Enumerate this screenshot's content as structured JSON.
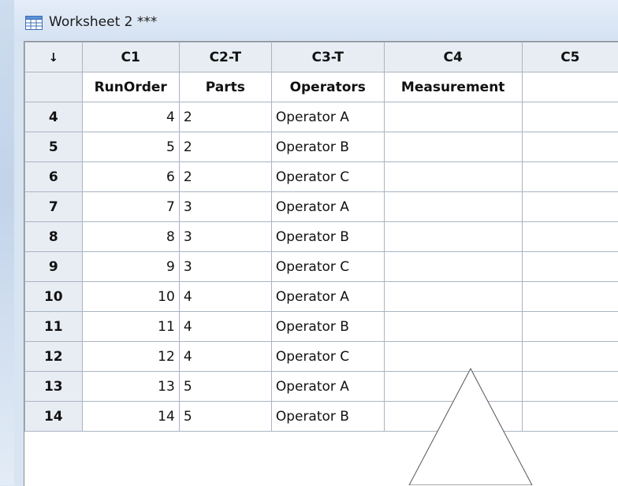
{
  "window": {
    "title": "Worksheet 2 ***",
    "icon": "worksheet-grid-icon"
  },
  "grid": {
    "corner_label": "↓",
    "column_ids": [
      "C1",
      "C2-T",
      "C3-T",
      "C4",
      "C5"
    ],
    "column_names": [
      "RunOrder",
      "Parts",
      "Operators",
      "Measurement",
      ""
    ],
    "rows": [
      {
        "row": "4",
        "c1": "4",
        "c2": "2",
        "c3": "Operator A",
        "c4": "",
        "c5": ""
      },
      {
        "row": "5",
        "c1": "5",
        "c2": "2",
        "c3": "Operator B",
        "c4": "",
        "c5": ""
      },
      {
        "row": "6",
        "c1": "6",
        "c2": "2",
        "c3": "Operator C",
        "c4": "",
        "c5": ""
      },
      {
        "row": "7",
        "c1": "7",
        "c2": "3",
        "c3": "Operator A",
        "c4": "",
        "c5": ""
      },
      {
        "row": "8",
        "c1": "8",
        "c2": "3",
        "c3": "Operator B",
        "c4": "",
        "c5": ""
      },
      {
        "row": "9",
        "c1": "9",
        "c2": "3",
        "c3": "Operator C",
        "c4": "",
        "c5": ""
      },
      {
        "row": "10",
        "c1": "10",
        "c2": "4",
        "c3": "Operator A",
        "c4": "",
        "c5": ""
      },
      {
        "row": "11",
        "c1": "11",
        "c2": "4",
        "c3": "Operator B",
        "c4": "",
        "c5": ""
      },
      {
        "row": "12",
        "c1": "12",
        "c2": "4",
        "c3": "Operator C",
        "c4": "",
        "c5": ""
      },
      {
        "row": "13",
        "c1": "13",
        "c2": "5",
        "c3": "Operator A",
        "c4": "",
        "c5": ""
      },
      {
        "row": "14",
        "c1": "14",
        "c2": "5",
        "c3": "Operator B",
        "c4": "",
        "c5": ""
      }
    ]
  },
  "colors": {
    "titlebar": "#d5e2f2",
    "header_bg": "#e8edf4",
    "grid_lines": "#a9b4c2"
  }
}
